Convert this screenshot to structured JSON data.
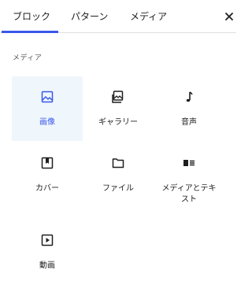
{
  "tabs": [
    {
      "label": "ブロック",
      "active": true
    },
    {
      "label": "パターン",
      "active": false
    },
    {
      "label": "メディア",
      "active": false
    }
  ],
  "close_label": "×",
  "accent_color": "#3858e9",
  "section": {
    "title": "メディア"
  },
  "blocks": [
    {
      "label": "画像",
      "icon": "image-icon",
      "selected": true
    },
    {
      "label": "ギャラリー",
      "icon": "gallery-icon",
      "selected": false
    },
    {
      "label": "音声",
      "icon": "audio-icon",
      "selected": false
    },
    {
      "label": "カバー",
      "icon": "cover-icon",
      "selected": false
    },
    {
      "label": "ファイル",
      "icon": "file-icon",
      "selected": false
    },
    {
      "label": "メディアとテキスト",
      "icon": "media-text-icon",
      "selected": false
    },
    {
      "label": "動画",
      "icon": "video-icon",
      "selected": false
    }
  ]
}
